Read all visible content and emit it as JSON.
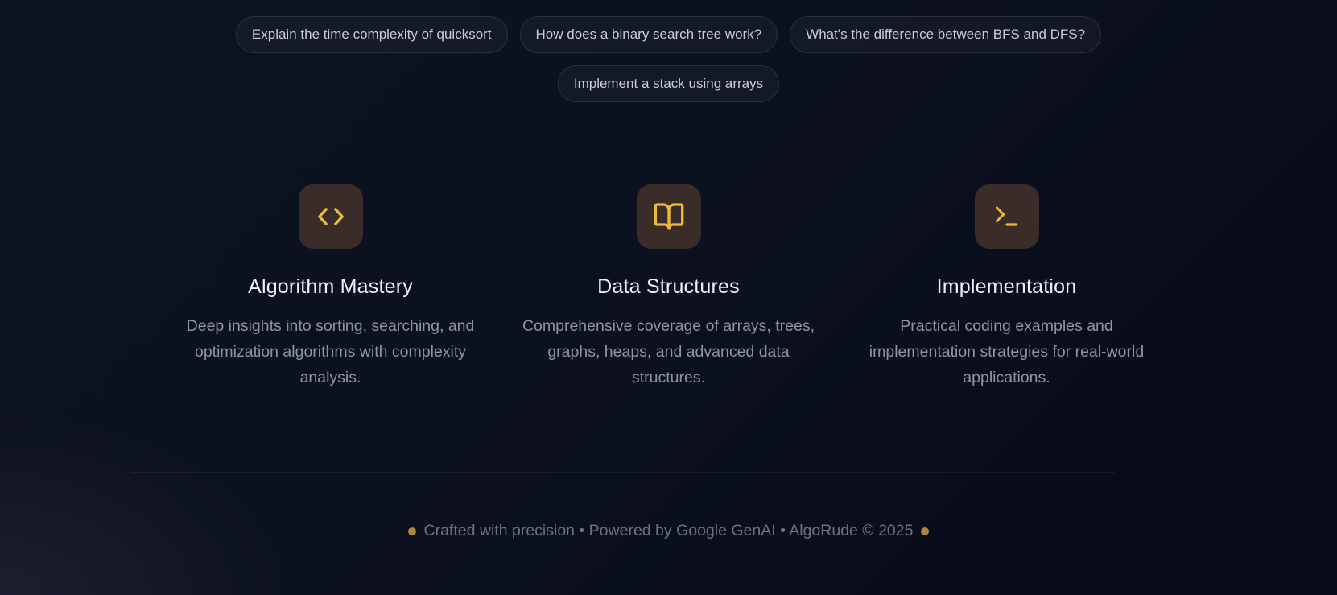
{
  "suggestions": [
    "Explain the time complexity of quicksort",
    "How does a binary search tree work?",
    "What's the difference between BFS and DFS?",
    "Implement a stack using arrays"
  ],
  "features": [
    {
      "icon": "code-icon",
      "title": "Algorithm Mastery",
      "description": "Deep insights into sorting, searching, and optimization algorithms with complexity analysis."
    },
    {
      "icon": "book-icon",
      "title": "Data Structures",
      "description": "Comprehensive coverage of arrays, trees, graphs, heaps, and advanced data structures."
    },
    {
      "icon": "terminal-icon",
      "title": "Implementation",
      "description": "Practical coding examples and implementation strategies for real-world applications."
    }
  ],
  "footer": {
    "text": "Crafted with precision • Powered by Google GenAI • AlgoRude © 2025"
  },
  "colors": {
    "accent": "#f0b93a",
    "icon_bg": "#3a2c28",
    "background": "#0c1120",
    "footer_dot": "#a8873e"
  }
}
